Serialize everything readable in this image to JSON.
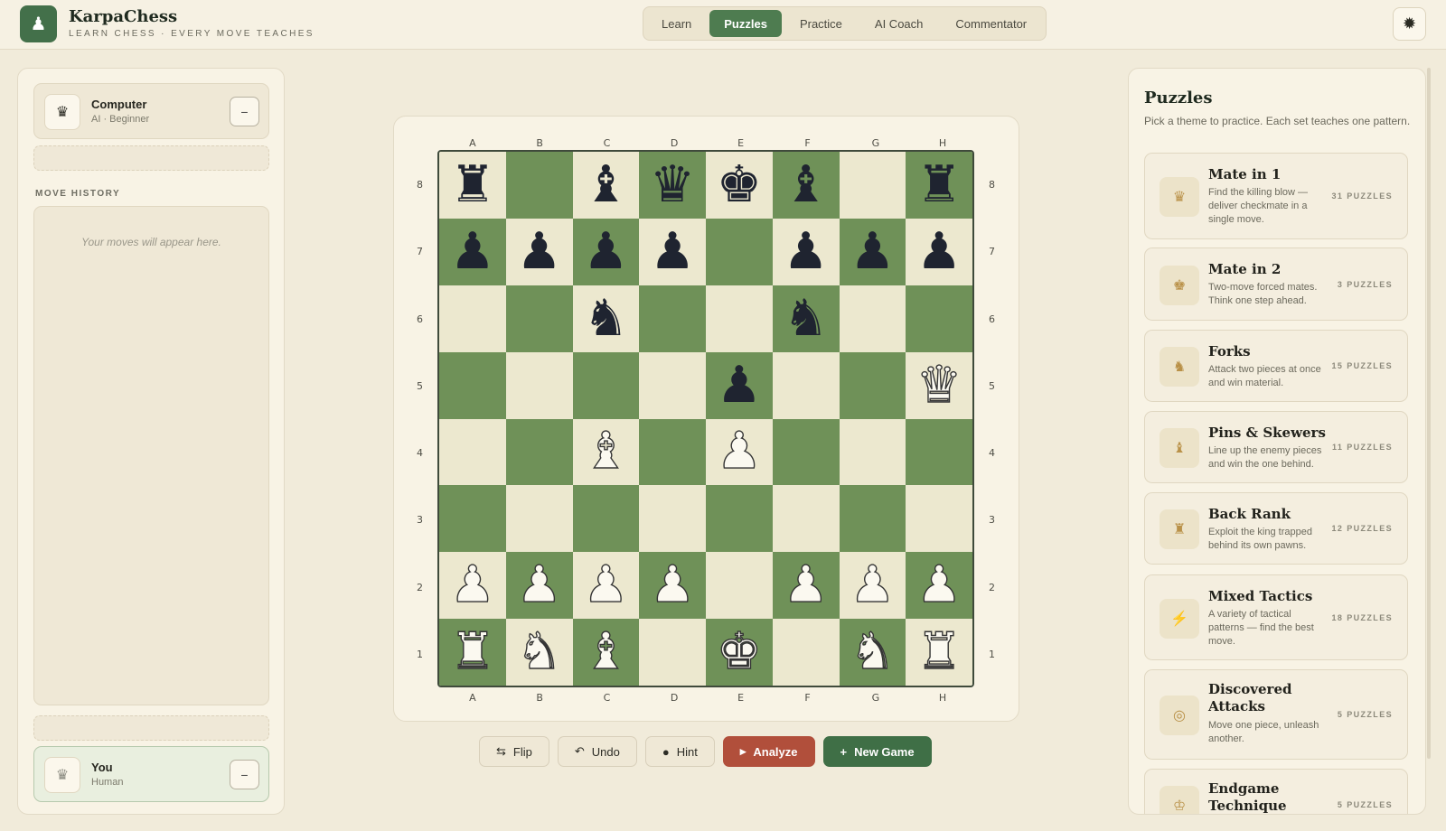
{
  "app": {
    "name": "KarpaChess",
    "tagline": "LEARN CHESS · EVERY MOVE TEACHES"
  },
  "nav": {
    "tabs": [
      "Learn",
      "Puzzles",
      "Practice",
      "AI Coach",
      "Commentator"
    ],
    "active": "Puzzles"
  },
  "icons": {
    "logo": "♟",
    "settings": "✹",
    "computer_avatar": "♛",
    "you_avatar": "♛",
    "collapse": "−",
    "flip": "⇆",
    "undo": "↶",
    "hint": "●",
    "analyze": "▸",
    "new_game": "+"
  },
  "players": {
    "top": {
      "name": "Computer",
      "subtitle": "AI · Beginner"
    },
    "bottom": {
      "name": "You",
      "subtitle": "Human"
    }
  },
  "move_history": {
    "title": "MOVE HISTORY",
    "empty": "Your moves will appear here."
  },
  "board": {
    "files": [
      "A",
      "B",
      "C",
      "D",
      "E",
      "F",
      "G",
      "H"
    ],
    "ranks": [
      "8",
      "7",
      "6",
      "5",
      "4",
      "3",
      "2",
      "1"
    ],
    "position": [
      [
        "r",
        "",
        "b",
        "q",
        "k",
        "b",
        "",
        "r"
      ],
      [
        "p",
        "p",
        "p",
        "p",
        "",
        "p",
        "p",
        "p"
      ],
      [
        "",
        "",
        "n",
        "",
        "",
        "n",
        "",
        ""
      ],
      [
        "",
        "",
        "",
        "",
        "p",
        "",
        "",
        "Q"
      ],
      [
        "",
        "",
        "B",
        "",
        "P",
        "",
        "",
        ""
      ],
      [
        "",
        "",
        "",
        "",
        "",
        "",
        "",
        ""
      ],
      [
        "P",
        "P",
        "P",
        "P",
        "",
        "P",
        "P",
        "P"
      ],
      [
        "R",
        "N",
        "B",
        "",
        "K",
        "",
        "N",
        "R"
      ]
    ]
  },
  "controls": {
    "flip": "Flip",
    "undo": "Undo",
    "hint": "Hint",
    "analyze": "Analyze",
    "new_game": "New Game"
  },
  "puzzles": {
    "title": "Puzzles",
    "description": "Pick a theme to practice. Each set teaches one pattern.",
    "items": [
      {
        "name": "Mate in 1",
        "desc": "Find the killing blow — deliver checkmate in a single move.",
        "count": "31 PUZZLES",
        "icon": "♛"
      },
      {
        "name": "Mate in 2",
        "desc": "Two-move forced mates. Think one step ahead.",
        "count": "3 PUZZLES",
        "icon": "♚"
      },
      {
        "name": "Forks",
        "desc": "Attack two pieces at once and win material.",
        "count": "15 PUZZLES",
        "icon": "♞"
      },
      {
        "name": "Pins & Skewers",
        "desc": "Line up the enemy pieces and win the one behind.",
        "count": "11 PUZZLES",
        "icon": "♝"
      },
      {
        "name": "Back Rank",
        "desc": "Exploit the king trapped behind its own pawns.",
        "count": "12 PUZZLES",
        "icon": "♜"
      },
      {
        "name": "Mixed Tactics",
        "desc": "A variety of tactical patterns — find the best move.",
        "count": "18 PUZZLES",
        "icon": "⚡"
      },
      {
        "name": "Discovered Attacks",
        "desc": "Move one piece, unleash another.",
        "count": "5 PUZZLES",
        "icon": "◎"
      },
      {
        "name": "Endgame Technique",
        "desc": "",
        "count": "5 PUZZLES",
        "icon": "♔"
      }
    ]
  }
}
